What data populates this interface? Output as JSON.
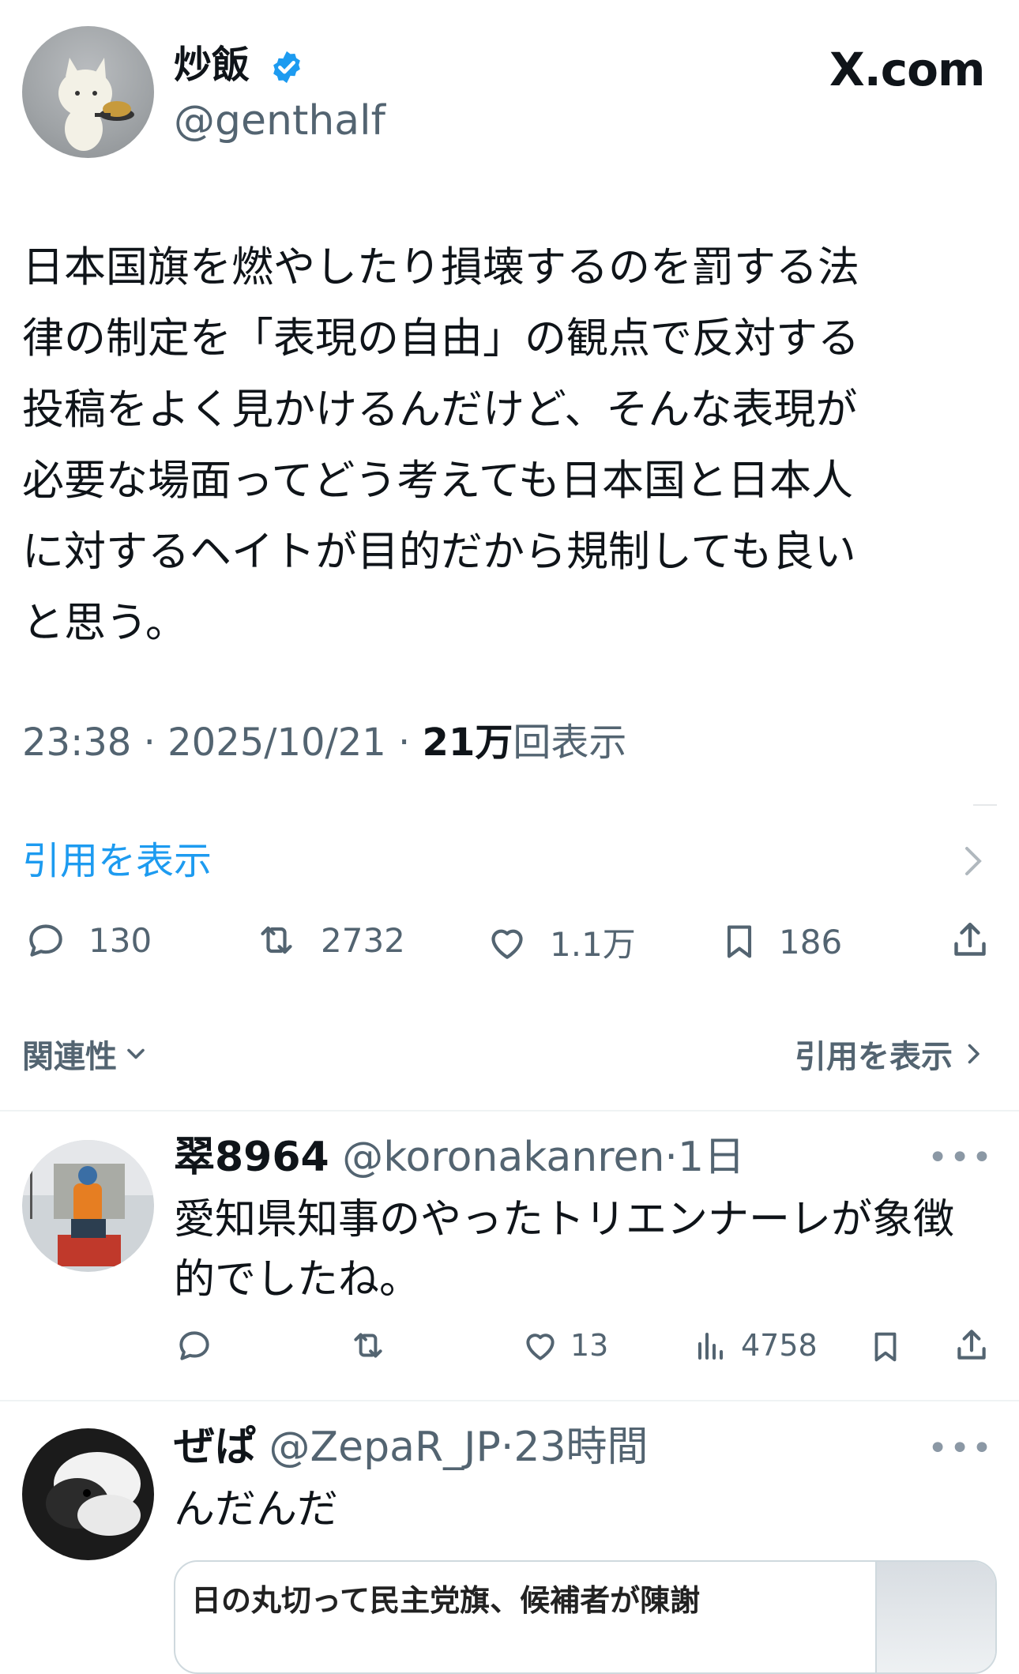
{
  "post": {
    "display_name": "炒飯",
    "handle": "@genthalf",
    "brand": "X.com",
    "text": "日本国旗を燃やしたり損壊するのを罰する法\n律の制定を「表現の自由」の観点で反対する\n投稿をよく見かけるんだけど、そんな表現が\n必要な場面ってどう考えても日本国と日本人\nに対するヘイトが目的だから規制しても良い\nと思う。",
    "time": "23:38",
    "date": "2025/10/21",
    "views_count": "21万",
    "views_label": "回表示",
    "quote_link": "引用を表示",
    "stats": {
      "replies": "130",
      "reposts": "2732",
      "likes": "1.1万",
      "bookmarks": "186"
    }
  },
  "section": {
    "left": "関連性",
    "right": "引用を表示"
  },
  "replies": [
    {
      "name": "翠8964",
      "handle": "@koronakanren",
      "time": "·1日",
      "text": "愛知県知事のやったトリエンナーレが象徴\n的でしたね。",
      "likes": "13",
      "views": "4758"
    },
    {
      "name": "ぜぱ",
      "handle": "@ZepaR_JP",
      "time": "·23時間",
      "text": "んだんだ",
      "card_title": "日の丸切って民主党旗、候補者が陳謝"
    }
  ],
  "colors": {
    "accent": "#1d9bf0",
    "muted": "#536471",
    "text": "#0f1419"
  },
  "icons": [
    "verified-badge-icon",
    "reply-icon",
    "repost-icon",
    "like-icon",
    "bookmark-icon",
    "share-icon",
    "views-icon",
    "chevron-down-icon",
    "chevron-right-icon",
    "more-icon"
  ]
}
